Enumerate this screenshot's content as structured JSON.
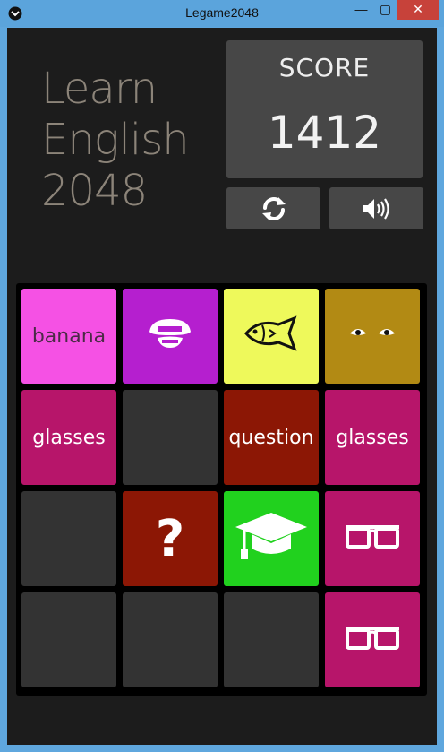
{
  "window": {
    "title": "Legame2048",
    "minimize": "—",
    "maximize": "▢",
    "close": "✕"
  },
  "logo": {
    "line1": "Learn",
    "line2": "English",
    "line3": "2048"
  },
  "score": {
    "label": "SCORE",
    "value": "1412"
  },
  "controls": {
    "restart_icon": "refresh-icon",
    "sound_icon": "speaker-icon"
  },
  "colors": {
    "pink": "#f551e4",
    "purple": "#b51fcf",
    "yellow": "#eef95b",
    "olive": "#b28a14",
    "magenta": "#b7156a",
    "empty": "#333333",
    "red": "#8c1705",
    "green": "#21d11e"
  },
  "board": {
    "tiles": [
      {
        "kind": "text",
        "text": "banana",
        "color": "#f551e4",
        "text_color": "#4a2b46"
      },
      {
        "kind": "icon",
        "icon": "mouth-icon",
        "color": "#b51fcf"
      },
      {
        "kind": "icon",
        "icon": "fish-icon",
        "color": "#eef95b"
      },
      {
        "kind": "icon",
        "icon": "eyes-icon",
        "color": "#b28a14"
      },
      {
        "kind": "text",
        "text": "glasses",
        "color": "#b7156a"
      },
      {
        "kind": "empty",
        "color": "#333333"
      },
      {
        "kind": "text",
        "text": "question",
        "color": "#8c1705"
      },
      {
        "kind": "text",
        "text": "glasses",
        "color": "#b7156a"
      },
      {
        "kind": "empty",
        "color": "#333333"
      },
      {
        "kind": "icon",
        "icon": "question-mark-icon",
        "text": "?",
        "color": "#8c1705"
      },
      {
        "kind": "icon",
        "icon": "graduation-cap-icon",
        "color": "#21d11e"
      },
      {
        "kind": "icon",
        "icon": "glasses-icon",
        "color": "#b7156a"
      },
      {
        "kind": "empty",
        "color": "#333333"
      },
      {
        "kind": "empty",
        "color": "#333333"
      },
      {
        "kind": "empty",
        "color": "#333333"
      },
      {
        "kind": "icon",
        "icon": "glasses-icon",
        "color": "#b7156a"
      }
    ]
  }
}
